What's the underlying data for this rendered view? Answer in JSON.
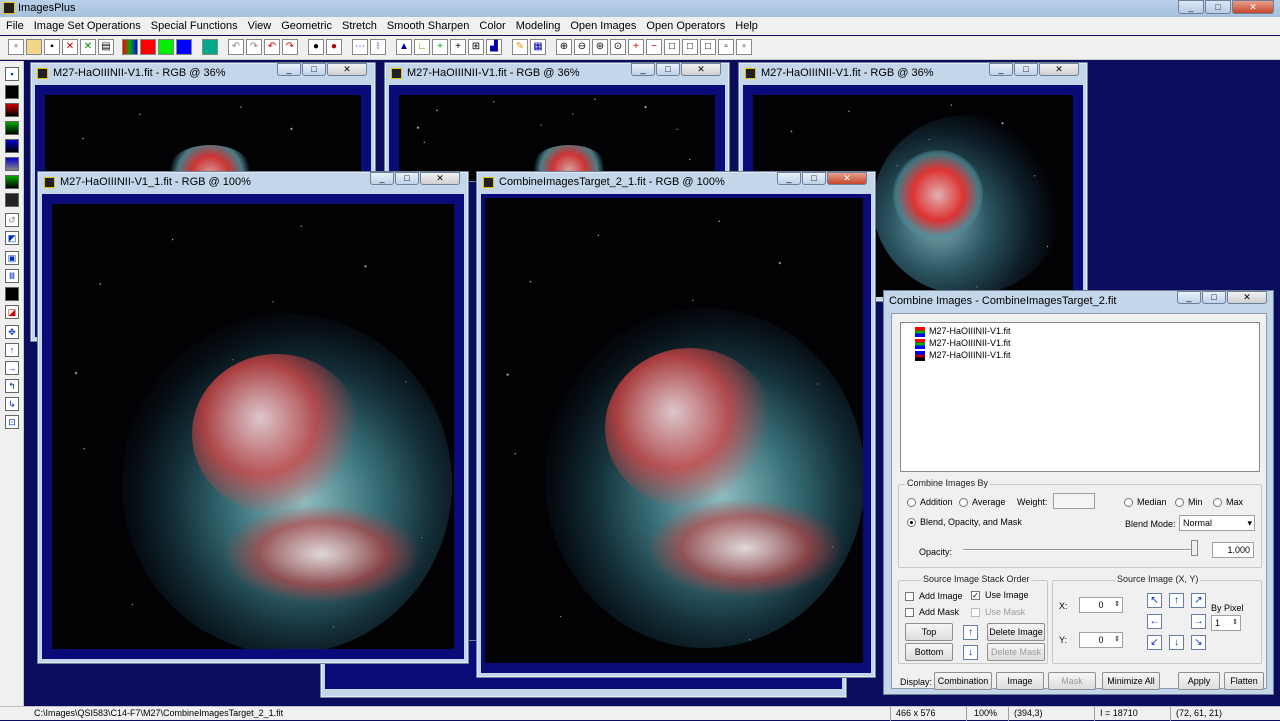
{
  "app": {
    "title": "ImagesPlus",
    "caption_buttons": [
      "_",
      "□",
      "✕"
    ]
  },
  "menu": [
    "File",
    "Image Set Operations",
    "Special Functions",
    "View",
    "Geometric",
    "Stretch",
    "Smooth Sharpen",
    "Color",
    "Modeling",
    "Open Images",
    "Open Operators",
    "Help"
  ],
  "windows": {
    "w1": {
      "title": "M27-HaOIIINII-V1.fit - RGB @ 36%"
    },
    "w2": {
      "title": "M27-HaOIIINII-V1.fit - RGB @ 36%"
    },
    "w3": {
      "title": "M27-HaOIIINII-V1.fit - RGB @ 36%"
    },
    "w4": {
      "title": "M27-HaOIIINII-V1_1.fit - RGB @ 100%"
    },
    "w5": {
      "title": "CombineImagesTarget_2_1.fit - RGB @ 100%"
    }
  },
  "dialog": {
    "title": "Combine Images - CombineImagesTarget_2.fit",
    "list_items": [
      "M27-HaOIIINII-V1.fit",
      "M27-HaOIIINII-V1.fit",
      "M27-HaOIIINII-V1.fit"
    ],
    "combine_by": {
      "label": "Combine Images By",
      "addition": "Addition",
      "average": "Average",
      "weight": "Weight:",
      "median": "Median",
      "min": "Min",
      "max": "Max",
      "blend": "Blend, Opacity, and Mask",
      "blend_mode_label": "Blend Mode:",
      "blend_mode_value": "Normal",
      "opacity_label": "Opacity:",
      "opacity_value": "1.000"
    },
    "stack": {
      "label": "Source Image Stack Order",
      "add_image": "Add Image",
      "use_image": "Use Image",
      "add_mask": "Add Mask",
      "use_mask": "Use Mask",
      "top": "Top",
      "bottom": "Bottom",
      "delete_image": "Delete Image",
      "delete_mask": "Delete Mask"
    },
    "source": {
      "label": "Source Image (X, Y)",
      "x_label": "X:",
      "x_value": "0",
      "y_label": "Y:",
      "y_value": "0",
      "by_pixel": "By Pixel",
      "by_pixel_value": "1"
    },
    "display_label": "Display:",
    "buttons": {
      "combination": "Combination",
      "image": "Image",
      "mask": "Mask",
      "minimize_all": "Minimize All",
      "apply": "Apply",
      "flatten": "Flatten"
    }
  },
  "status": {
    "path": "C:\\Images\\QSI583\\C14-F7\\M27\\CombineImagesTarget_2_1.fit",
    "size": "466 x 576",
    "zoom": "100%",
    "coords": "(394,3)",
    "intensity": "I = 18710",
    "rgb": "(72, 61, 21)"
  }
}
